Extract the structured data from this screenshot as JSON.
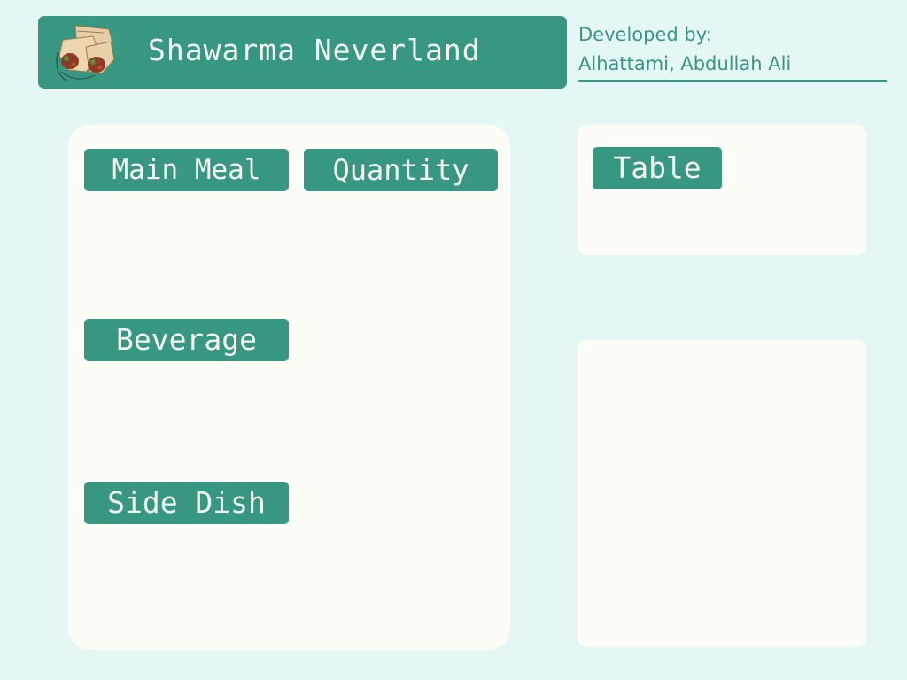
{
  "header": {
    "title": "Shawarma Neverland",
    "logo_icon": "shawarma-wrap-icon"
  },
  "credits": {
    "label": "Developed by:",
    "name": "Alhattami, Abdullah Ali"
  },
  "order_panel": {
    "main_meal_label": "Main Meal",
    "quantity_label": "Quantity",
    "beverage_label": "Beverage",
    "side_dish_label": "Side Dish"
  },
  "table_panel": {
    "table_label": "Table"
  },
  "colors": {
    "background": "#e4f7f4",
    "accent": "#389781",
    "panel": "#fcfdf7",
    "label_text": "#f3f6ef"
  }
}
